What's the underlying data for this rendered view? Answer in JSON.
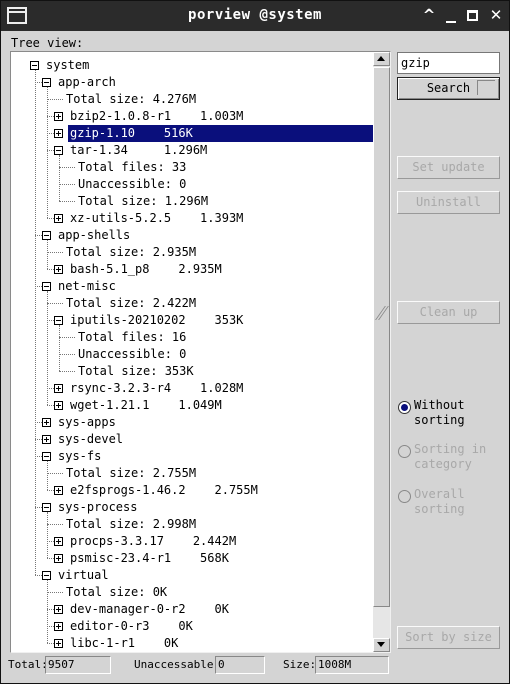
{
  "window": {
    "title": "porview @system",
    "minimize_glyph": "^",
    "close_glyph": "✕"
  },
  "tree": {
    "label": "Tree view:",
    "rows": [
      {
        "text": "system",
        "depth": 0,
        "exp": "minus"
      },
      {
        "text": "app-arch",
        "depth": 1,
        "exp": "minus"
      },
      {
        "text": "Total size: 4.276M",
        "depth": 2,
        "exp": null
      },
      {
        "text": "bzip2-1.0.8-r1    1.003M",
        "depth": 2,
        "exp": "plus"
      },
      {
        "text": "gzip-1.10    516K",
        "depth": 2,
        "exp": "plus",
        "selected": true
      },
      {
        "text": "tar-1.34     1.296M",
        "depth": 2,
        "exp": "minus"
      },
      {
        "text": "Total files: 33",
        "depth": 3,
        "exp": null
      },
      {
        "text": "Unaccessible: 0",
        "depth": 3,
        "exp": null
      },
      {
        "text": "Total size: 1.296M",
        "depth": 3,
        "exp": null
      },
      {
        "text": "xz-utils-5.2.5    1.393M",
        "depth": 2,
        "exp": "plus"
      },
      {
        "text": "app-shells",
        "depth": 1,
        "exp": "minus"
      },
      {
        "text": "Total size: 2.935M",
        "depth": 2,
        "exp": null
      },
      {
        "text": "bash-5.1_p8    2.935M",
        "depth": 2,
        "exp": "plus"
      },
      {
        "text": "net-misc",
        "depth": 1,
        "exp": "minus"
      },
      {
        "text": "Total size: 2.422M",
        "depth": 2,
        "exp": null
      },
      {
        "text": "iputils-20210202    353K",
        "depth": 2,
        "exp": "minus"
      },
      {
        "text": "Total files: 16",
        "depth": 3,
        "exp": null
      },
      {
        "text": "Unaccessible: 0",
        "depth": 3,
        "exp": null
      },
      {
        "text": "Total size: 353K",
        "depth": 3,
        "exp": null
      },
      {
        "text": "rsync-3.2.3-r4    1.028M",
        "depth": 2,
        "exp": "plus"
      },
      {
        "text": "wget-1.21.1    1.049M",
        "depth": 2,
        "exp": "plus"
      },
      {
        "text": "sys-apps",
        "depth": 1,
        "exp": "plus"
      },
      {
        "text": "sys-devel",
        "depth": 1,
        "exp": "plus"
      },
      {
        "text": "sys-fs",
        "depth": 1,
        "exp": "minus"
      },
      {
        "text": "Total size: 2.755M",
        "depth": 2,
        "exp": null
      },
      {
        "text": "e2fsprogs-1.46.2    2.755M",
        "depth": 2,
        "exp": "plus"
      },
      {
        "text": "sys-process",
        "depth": 1,
        "exp": "minus"
      },
      {
        "text": "Total size: 2.998M",
        "depth": 2,
        "exp": null
      },
      {
        "text": "procps-3.3.17    2.442M",
        "depth": 2,
        "exp": "plus"
      },
      {
        "text": "psmisc-23.4-r1    568K",
        "depth": 2,
        "exp": "plus"
      },
      {
        "text": "virtual",
        "depth": 1,
        "exp": "minus"
      },
      {
        "text": "Total size: 0K",
        "depth": 2,
        "exp": null
      },
      {
        "text": "dev-manager-0-r2    0K",
        "depth": 2,
        "exp": "plus"
      },
      {
        "text": "editor-0-r3    0K",
        "depth": 2,
        "exp": "plus"
      },
      {
        "text": "libc-1-r1    0K",
        "depth": 2,
        "exp": "plus"
      }
    ]
  },
  "search": {
    "value": "gzip",
    "button_label": "Search"
  },
  "actions": {
    "set_update": "Set update",
    "uninstall": "Uninstall",
    "clean_up": "Clean up",
    "sort_by_size": "Sort by size"
  },
  "sorting": {
    "without": "Without sorting",
    "in_category": "Sorting in category",
    "overall": "Overall sorting",
    "selected": "without"
  },
  "status": {
    "total_label": "Total:",
    "total_value": "9507",
    "unaccessable_label": "Unaccessable:",
    "unaccessable_value": "0",
    "size_label": "Size:",
    "size_value": "1008M"
  },
  "colors": {
    "selection": "#0a0f7c",
    "titlebar": "#2b2b2b",
    "window_bg": "#d4d4d4",
    "disabled_text": "#a8a8a8"
  }
}
